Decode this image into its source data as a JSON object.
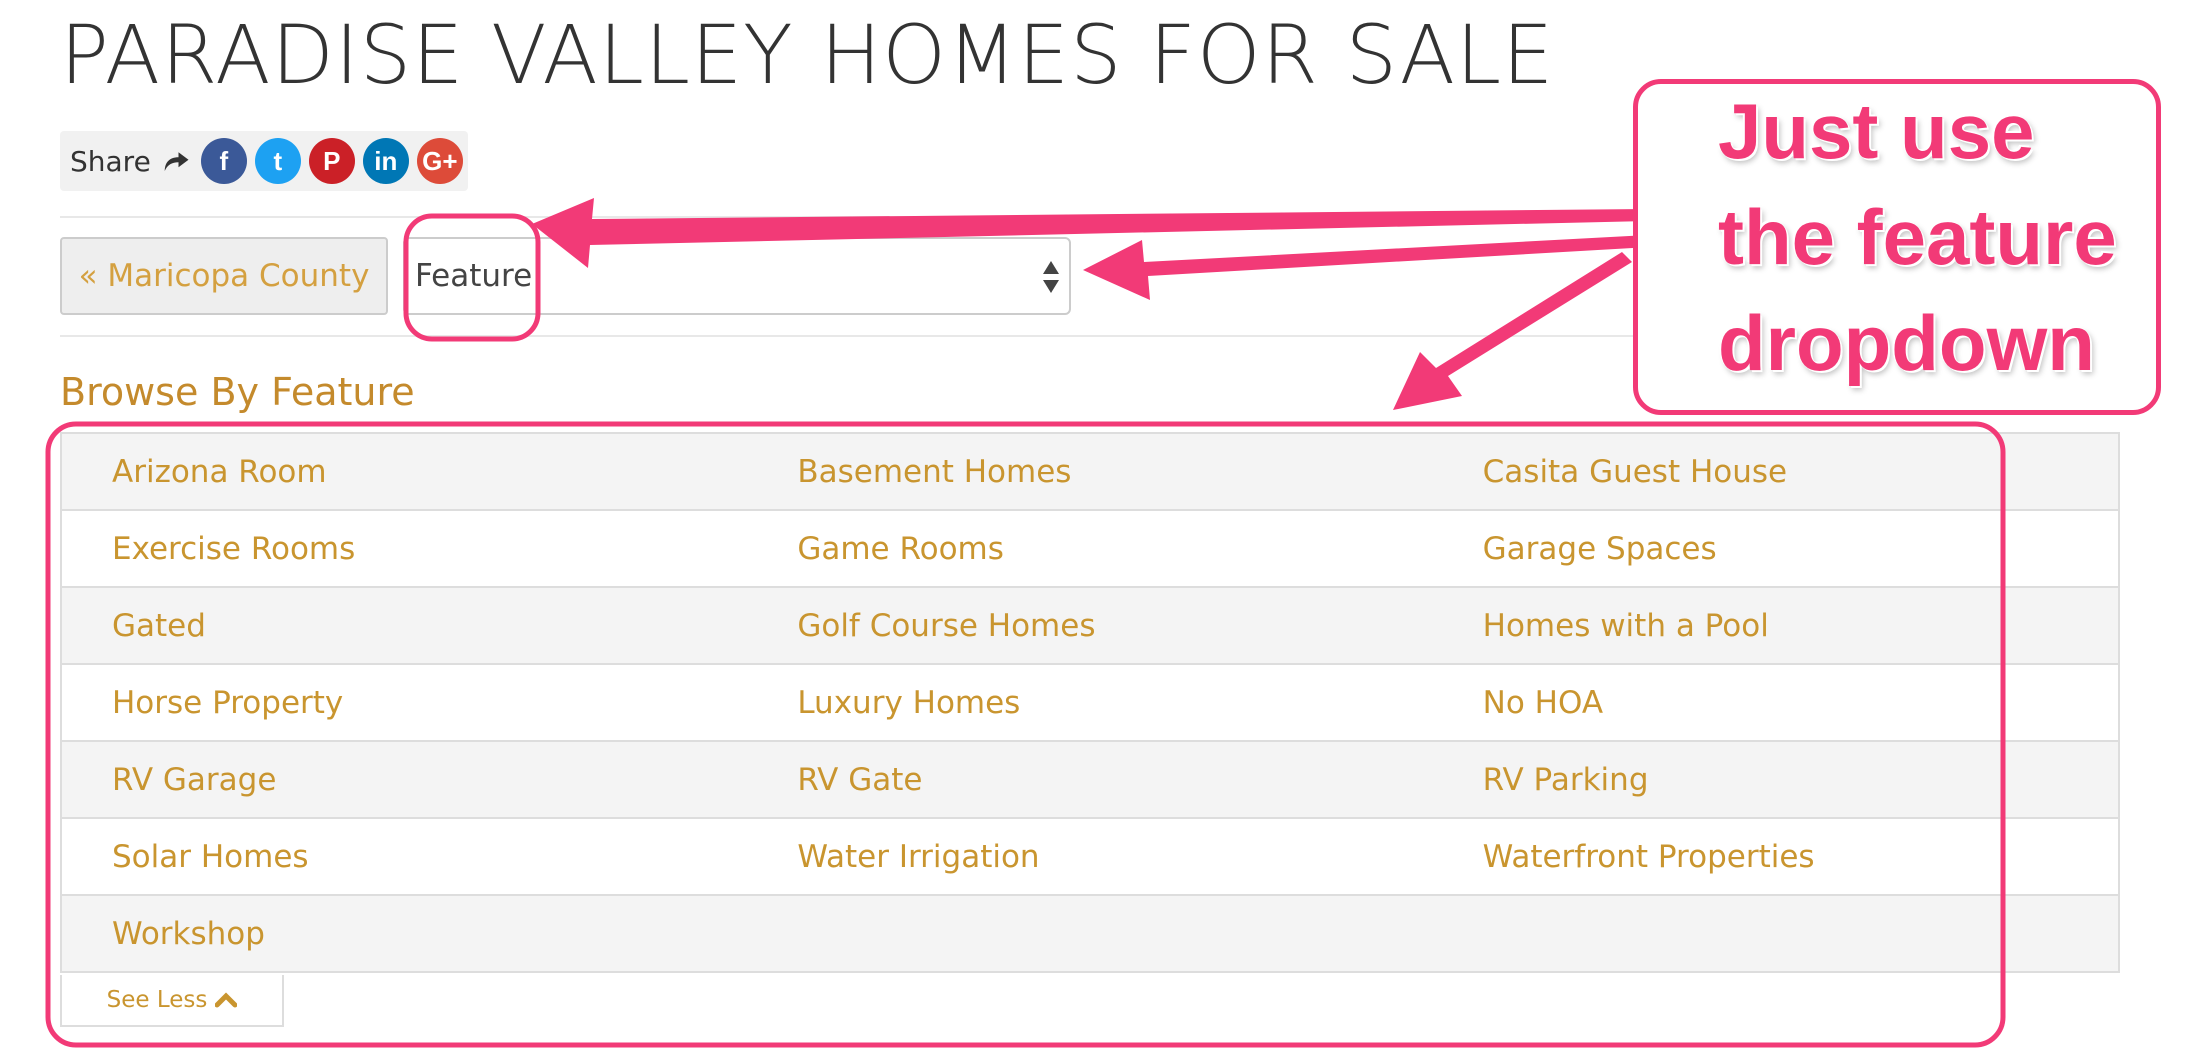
{
  "header": {
    "title": "PARADISE VALLEY HOMES FOR SALE"
  },
  "share": {
    "label": "Share",
    "networks": [
      {
        "name": "facebook",
        "glyph": "f",
        "color": "#3b5998"
      },
      {
        "name": "twitter",
        "glyph": "t",
        "color": "#1da1f2"
      },
      {
        "name": "pinterest",
        "glyph": "P",
        "color": "#cb2027"
      },
      {
        "name": "linkedin",
        "glyph": "in",
        "color": "#0077b5"
      },
      {
        "name": "google-plus",
        "glyph": "G+",
        "color": "#dd4b39"
      }
    ]
  },
  "filters": {
    "back_link": "« Maricopa County",
    "feature_select": {
      "selected": "Feature"
    }
  },
  "browse": {
    "title": "Browse By Feature",
    "rows": [
      [
        "Arizona Room",
        "Basement Homes",
        "Casita Guest House"
      ],
      [
        "Exercise Rooms",
        "Game Rooms",
        "Garage Spaces"
      ],
      [
        "Gated",
        "Golf Course Homes",
        "Homes with a Pool"
      ],
      [
        "Horse Property",
        "Luxury Homes",
        "No HOA"
      ],
      [
        "RV Garage",
        "RV Gate",
        "RV Parking"
      ],
      [
        "Solar Homes",
        "Water Irrigation",
        "Waterfront Properties"
      ],
      [
        "Workshop",
        "",
        ""
      ]
    ],
    "see_less": "See Less"
  },
  "annotation": {
    "lines": [
      "Just use",
      "the feature",
      "dropdown"
    ],
    "color": "#f23a77"
  },
  "colors": {
    "link": "#c9952f",
    "title": "#333333"
  }
}
